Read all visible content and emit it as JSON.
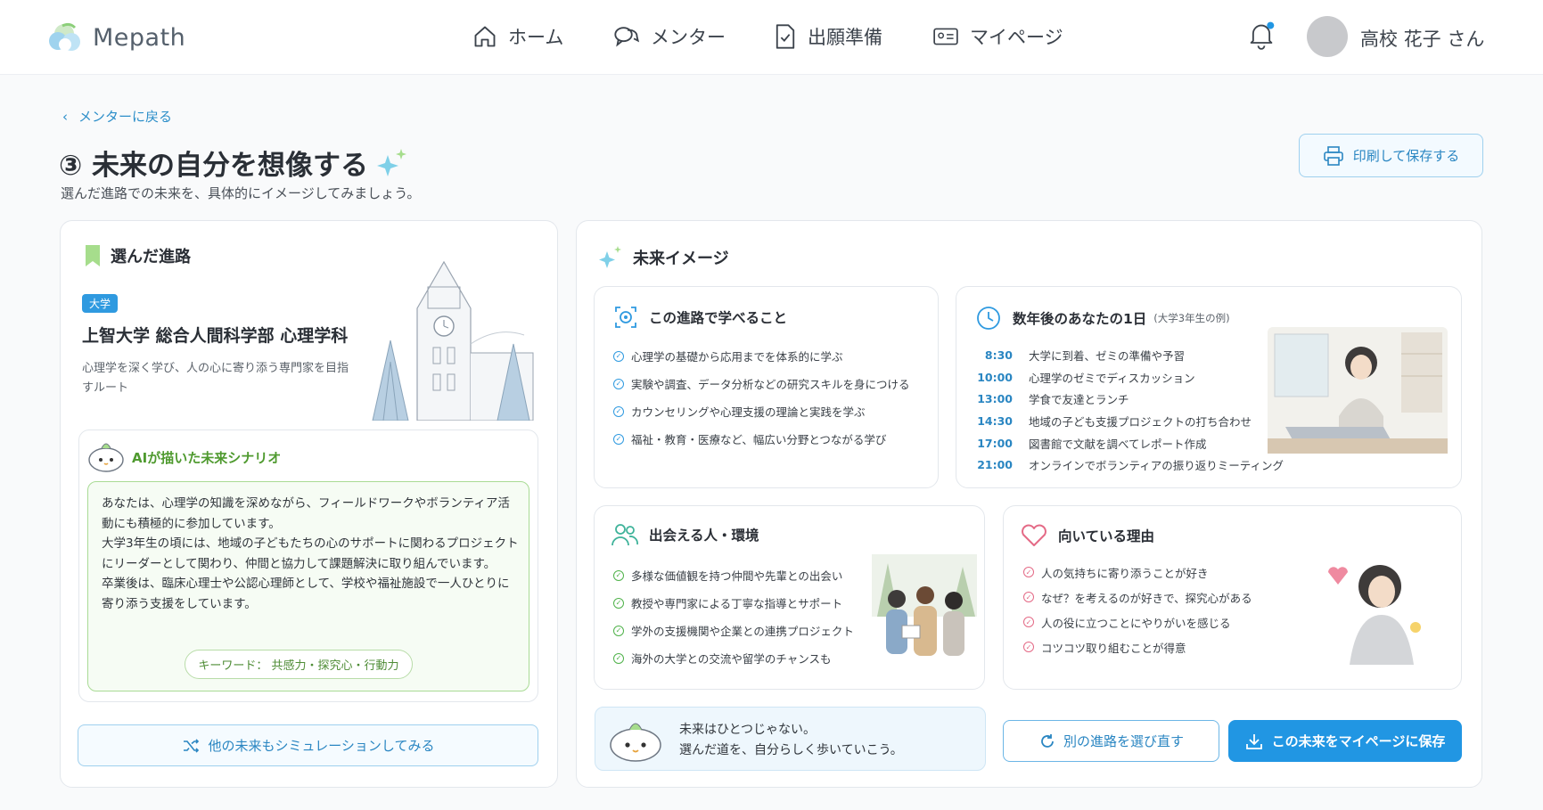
{
  "header": {
    "logo_text": "Mepath",
    "nav": [
      {
        "label": "ホーム",
        "icon": "home-icon"
      },
      {
        "label": "メンター",
        "icon": "chat-icon"
      },
      {
        "label": "出願準備",
        "icon": "document-check-icon"
      },
      {
        "label": "マイページ",
        "icon": "id-card-icon"
      }
    ],
    "user_name": "高校 花子 さん"
  },
  "page": {
    "back_link": "メンターに戻る",
    "title": "③ 未来の自分を想像する",
    "subtitle": "選んだ進路での未来を、具体的にイメージしてみましょう。",
    "print_button": "印刷して保存する"
  },
  "left_panel": {
    "section_title": "選んだ進路",
    "badge": "大学",
    "university": "上智大学 総合人間科学部 心理学科",
    "description": "心理学を深く学び、人の心に寄り添う専門家を目指すルート",
    "ai_scenario": {
      "title": "AIが描いた未来シナリオ",
      "paragraphs": [
        "あなたは、心理学の知識を深めながら、フィールドワークやボランティア活動にも積極的に参加しています。",
        "大学3年生の頃には、地域の子どもたちの心のサポートに関わるプロジェクトにリーダーとして関わり、仲間と協力して課題解決に取り組んでいます。",
        "卒業後は、臨床心理士や公認心理師として、学校や福祉施設で一人ひとりに寄り添う支援をしています。"
      ],
      "keywords": "キーワード： 共感力・探究心・行動力"
    },
    "simulate_button": "他の未来もシミュレーションしてみる"
  },
  "future": {
    "section_title": "未来イメージ",
    "learn": {
      "title": "この進路で学べること",
      "items": [
        "心理学の基礎から応用までを体系的に学ぶ",
        "実験や調査、データ分析などの研究スキルを身につける",
        "カウンセリングや心理支援の理論と実践を学ぶ",
        "福祉・教育・医療など、幅広い分野とつながる学び"
      ]
    },
    "day": {
      "title": "数年後のあなたの1日",
      "note": "(大学3年生の例)",
      "schedule": [
        {
          "time": "8:30",
          "text": "大学に到着、ゼミの準備や予習"
        },
        {
          "time": "10:00",
          "text": "心理学のゼミでディスカッション"
        },
        {
          "time": "13:00",
          "text": "学食で友達とランチ"
        },
        {
          "time": "14:30",
          "text": "地域の子ども支援プロジェクトの打ち合わせ"
        },
        {
          "time": "17:00",
          "text": "図書館で文献を調べてレポート作成"
        },
        {
          "time": "21:00",
          "text": "オンラインでボランティアの振り返りミーティング"
        }
      ]
    },
    "people": {
      "title": "出会える人・環境",
      "items": [
        "多様な価値観を持つ仲間や先輩との出会い",
        "教授や専門家による丁寧な指導とサポート",
        "学外の支援機関や企業との連携プロジェクト",
        "海外の大学との交流や留学のチャンスも"
      ]
    },
    "reasons": {
      "title": "向いている理由",
      "items": [
        "人の気持ちに寄り添うことが好き",
        "なぜ？を考えるのが好きで、探究心がある",
        "人の役に立つことにやりがいを感じる",
        "コツコツ取り組むことが得意"
      ]
    },
    "message": {
      "line1": "未来はひとつじゃない。",
      "line2": "選んだ道を、自分らしく歩いていこう。"
    },
    "alt_button": "別の進路を選び直す",
    "save_button": "この未来をマイページに保存"
  },
  "colors": {
    "accent": "#2196e3",
    "green": "#4f9a2f",
    "pink": "#e46a86",
    "teal": "#3fb39a"
  }
}
